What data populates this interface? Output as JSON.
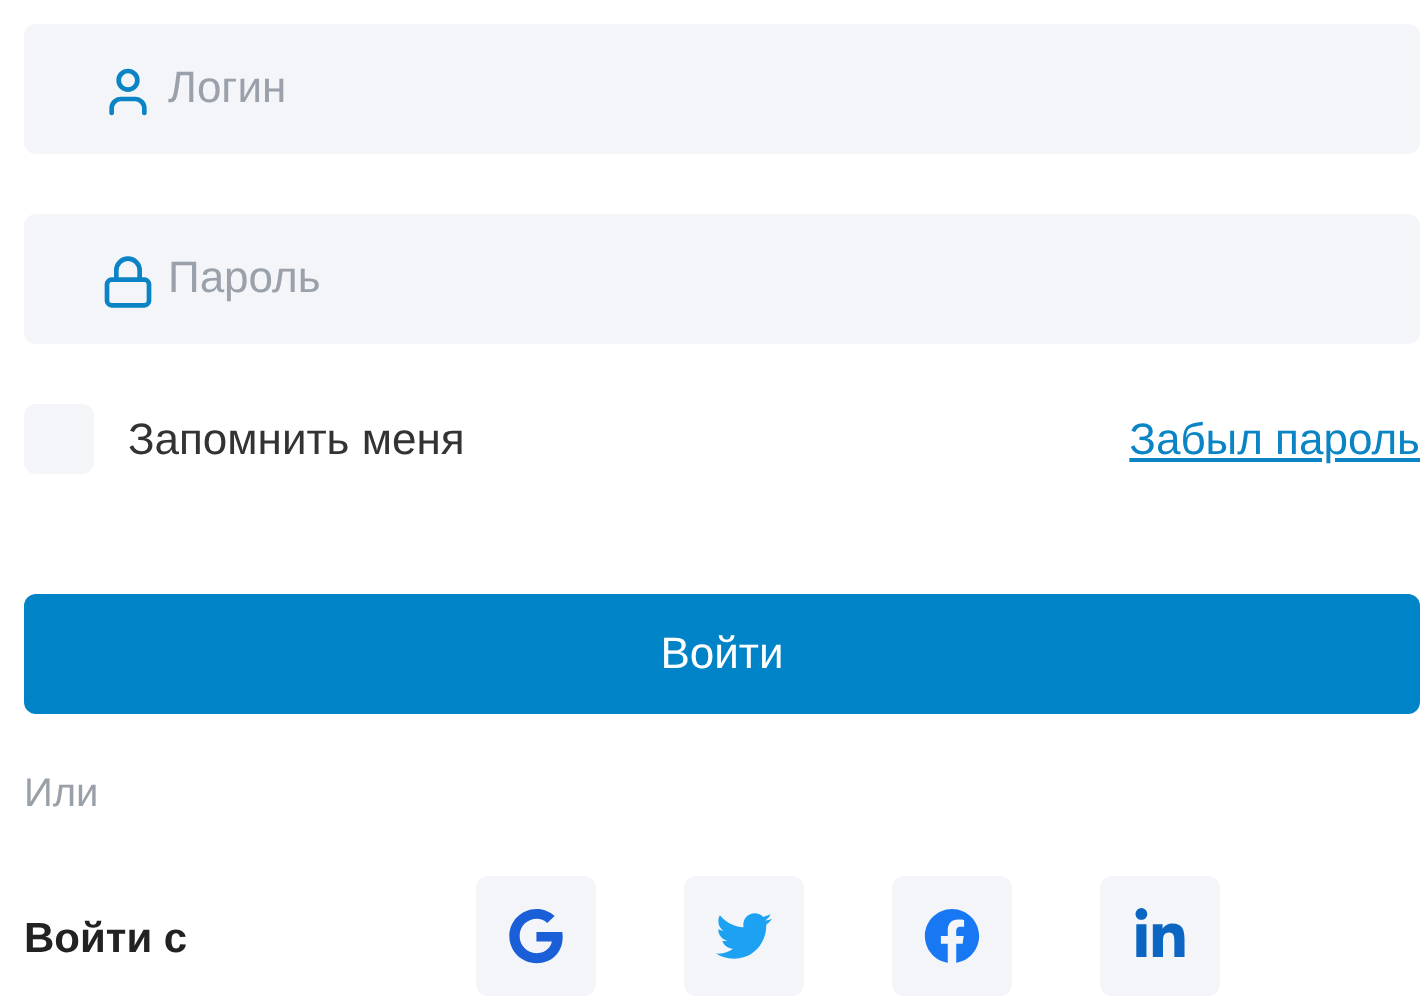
{
  "fields": [
    {
      "kind": "login",
      "placeholder": "Логин"
    },
    {
      "kind": "password",
      "placeholder": "Пароль"
    }
  ],
  "remember": {
    "label": "Запомнить меня",
    "checked": false
  },
  "forgot_link": "Забыл пароль",
  "submit": "Войти",
  "divider": "Или",
  "social": {
    "label": "Войти с",
    "providers": [
      {
        "kind": "google"
      },
      {
        "kind": "twitter"
      },
      {
        "kind": "facebook"
      },
      {
        "kind": "linkedin"
      }
    ]
  }
}
